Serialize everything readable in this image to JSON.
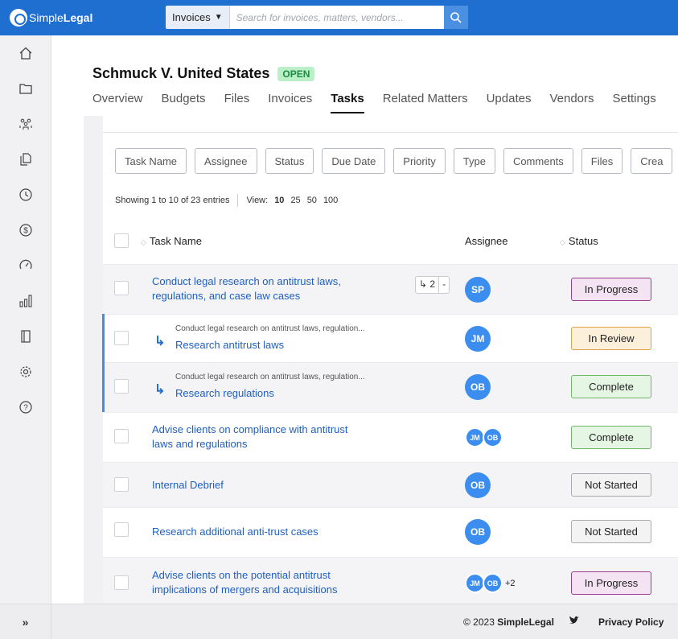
{
  "app": {
    "logo_light": "Simple",
    "logo_bold": "Legal"
  },
  "search": {
    "type_label": "Invoices",
    "placeholder": "Search for invoices, matters, vendors..."
  },
  "sidebar": {
    "items": [
      {
        "icon": "home-icon"
      },
      {
        "icon": "folder-icon"
      },
      {
        "icon": "people-icon"
      },
      {
        "icon": "documents-icon"
      },
      {
        "icon": "clock-icon"
      },
      {
        "icon": "dollar-icon"
      },
      {
        "icon": "gauge-icon"
      },
      {
        "icon": "bar-chart-icon"
      },
      {
        "icon": "book-icon"
      },
      {
        "icon": "gear-icon"
      },
      {
        "icon": "help-icon"
      }
    ]
  },
  "matter": {
    "title": "Schmuck V. United States",
    "status": "OPEN"
  },
  "tabs": [
    "Overview",
    "Budgets",
    "Files",
    "Invoices",
    "Tasks",
    "Related Matters",
    "Updates",
    "Vendors",
    "Settings"
  ],
  "active_tab": "Tasks",
  "column_filters": [
    "Task Name",
    "Assignee",
    "Status",
    "Due Date",
    "Priority",
    "Type",
    "Comments",
    "Files",
    "Crea"
  ],
  "pagination": {
    "showing": "Showing 1 to 10 of 23 entries",
    "view_label": "View:",
    "options": [
      "10",
      "25",
      "50",
      "100"
    ],
    "selected": "10"
  },
  "table": {
    "headers": {
      "task_name": "Task Name",
      "assignee": "Assignee",
      "status": "Status"
    },
    "rows": [
      {
        "line1": "Conduct legal research on antitrust laws,",
        "line2": "regulations, and case law cases",
        "subtask_count": "↳ 2",
        "subtask_toggle": "-",
        "assignees": [
          "SP"
        ],
        "status": "In Progress"
      },
      {
        "parent": "Conduct legal research on antitrust laws, regulation...",
        "name": "Research antitrust laws",
        "assignees": [
          "JM"
        ],
        "status": "In Review"
      },
      {
        "parent": "Conduct legal research on antitrust laws, regulation...",
        "name": "Research regulations",
        "assignees": [
          "OB"
        ],
        "status": "Complete"
      },
      {
        "line1": "Advise clients on compliance with antitrust",
        "line2": "laws and regulations",
        "assignees": [
          "JM",
          "OB"
        ],
        "status": "Complete"
      },
      {
        "line1": "Internal Debrief",
        "assignees": [
          "OB"
        ],
        "status": "Not Started"
      },
      {
        "line1": "Research additional anti-trust cases",
        "assignees": [
          "OB"
        ],
        "status": "Not Started"
      },
      {
        "line1": "Advise clients on the potential antitrust",
        "line2": "implications of mergers and acquisitions",
        "assignees": [
          "JM",
          "OB"
        ],
        "more_assignees": "+2",
        "status": "In Progress"
      }
    ]
  },
  "footer": {
    "copyright_prefix": "© 2023",
    "copyright_brand": "SimpleLegal",
    "privacy": "Privacy Policy",
    "expand": "»"
  },
  "colors": {
    "brand_blue": "#1f6fd0",
    "link_blue": "#1f5fbf",
    "avatar_blue": "#3b8df0",
    "open_badge_bg": "#b9f0c8"
  }
}
